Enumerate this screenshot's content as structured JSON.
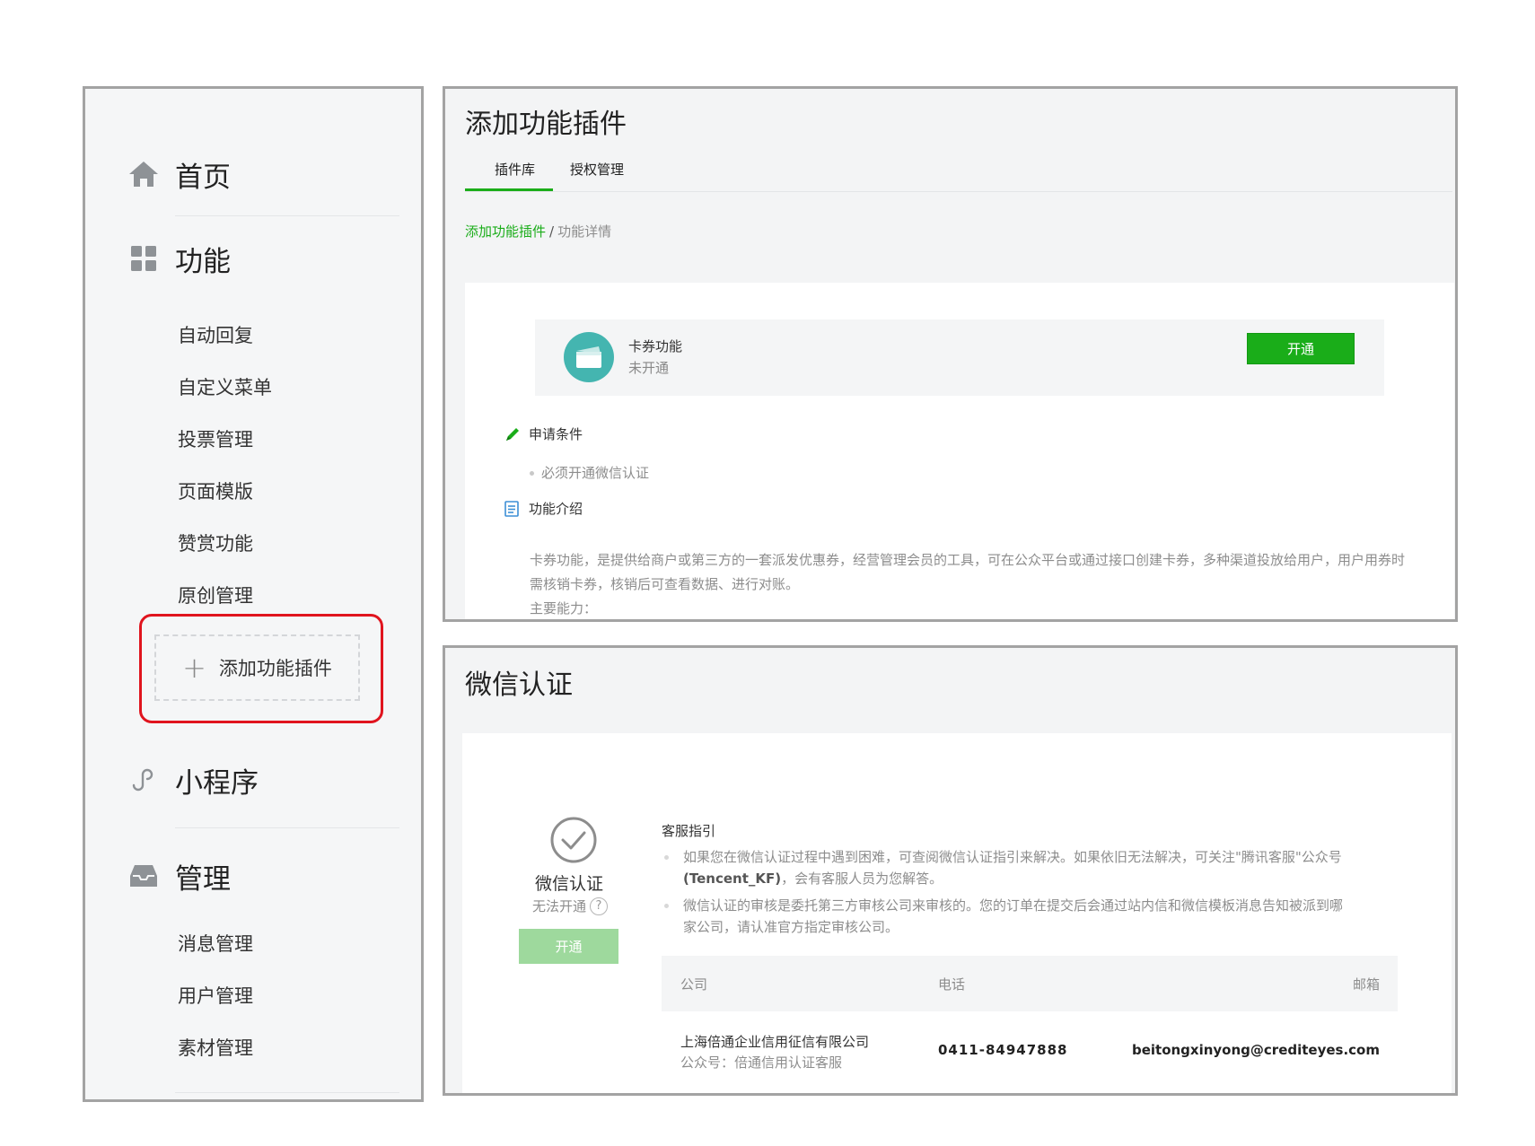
{
  "sidebar": {
    "home_label": "首页",
    "function_label": "功能",
    "function_items": [
      "自动回复",
      "自定义菜单",
      "投票管理",
      "页面模版",
      "赞赏功能",
      "原创管理"
    ],
    "add_plugin_label": "添加功能插件",
    "miniprogram_label": "小程序",
    "manage_label": "管理",
    "manage_items": [
      "消息管理",
      "用户管理",
      "素材管理"
    ]
  },
  "plugin_panel": {
    "title": "添加功能插件",
    "tabs": [
      "插件库",
      "授权管理"
    ],
    "breadcrumb": {
      "link": "添加功能插件",
      "separator": "/",
      "current": "功能详情"
    },
    "plugin": {
      "name": "卡券功能",
      "status": "未开通",
      "button": "开通"
    },
    "requirements": {
      "heading": "申请条件",
      "items": [
        "必须开通微信认证"
      ]
    },
    "intro": {
      "heading": "功能介绍",
      "text": "卡券功能，是提供给商户或第三方的一套派发优惠券，经营管理会员的工具，可在公众平台或通过接口创建卡券，多种渠道投放给用户，用户用券时需核销卡券，核销后可查看数据、进行对账。",
      "abilities_label": "主要能力："
    }
  },
  "verify_panel": {
    "title": "微信认证",
    "name": "微信认证",
    "status": "无法开通",
    "help_icon": "?",
    "button": "开通",
    "guide": {
      "title": "客服指引",
      "item1_part1": "如果您在微信认证过程中遇到困难，可查阅微信认证指引来解决。如果依旧无法解决，可关注\"腾讯客服\"公众号",
      "item1_strong": "(Tencent_KF)",
      "item1_part2": "，会有客服人员为您解答。",
      "item2": "微信认证的审核是委托第三方审核公司来审核的。您的订单在提交后会通过站内信和微信模板消息告知被派到哪家公司，请认准官方指定审核公司。"
    },
    "table": {
      "headers": [
        "公司",
        "电话",
        "邮箱"
      ],
      "rows": [
        {
          "company": "上海倍通企业信用征信有限公司",
          "account": "公众号：倍通信用认证客服",
          "phone": "0411-84947888",
          "email": "beitongxinyong@crediteyes.com"
        }
      ]
    }
  },
  "colors": {
    "brand_green": "#1aad19",
    "highlight_red": "#e0141e",
    "plugin_icon_teal": "#44b5b0"
  }
}
